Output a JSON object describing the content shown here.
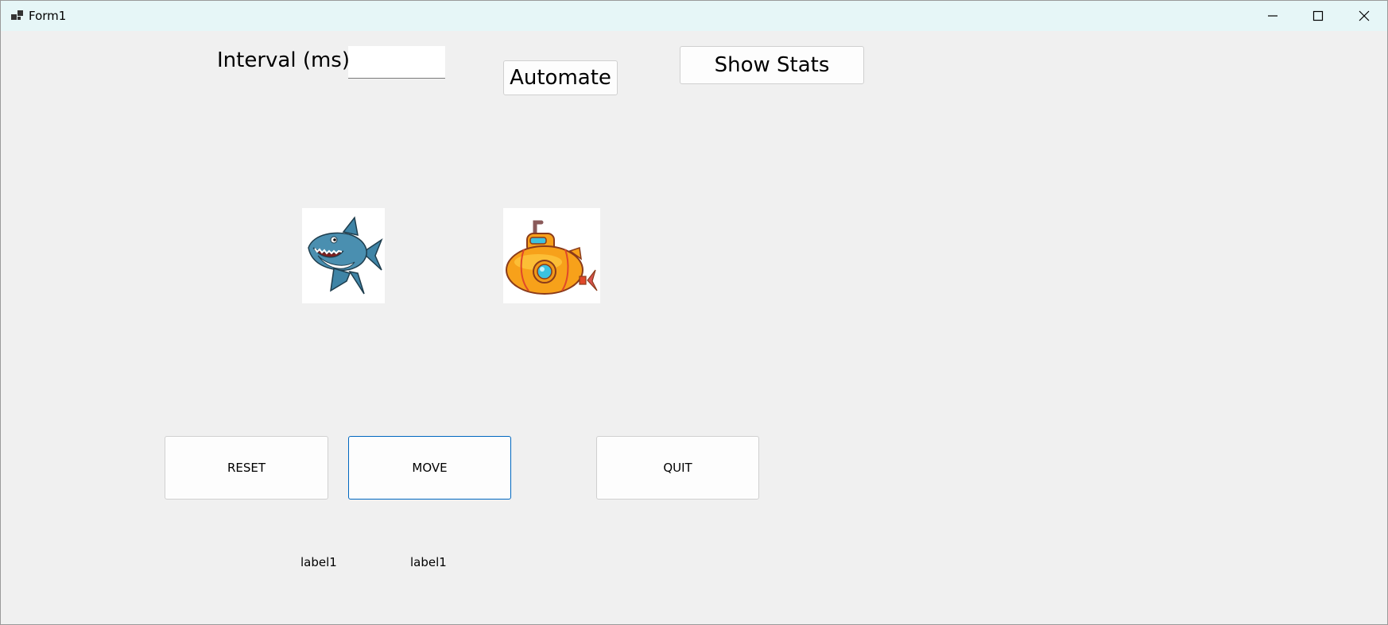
{
  "window": {
    "title": "Form1",
    "icons": {
      "app": "form-app-icon",
      "minimize": "minimize-icon",
      "maximize": "maximize-icon",
      "close": "close-icon"
    }
  },
  "controls": {
    "interval_label": "Interval (ms)",
    "interval_value": "",
    "automate_label": "Automate",
    "show_stats_label": "Show Stats",
    "reset_label": "RESET",
    "move_label": "MOVE",
    "quit_label": "QUIT"
  },
  "images": {
    "shark": "shark-image",
    "submarine": "submarine-image"
  },
  "labels": {
    "label_a": "label1",
    "label_b": "label1"
  },
  "colors": {
    "titlebar_bg": "#e6f6f7",
    "client_bg": "#f0f0f0",
    "focus_border": "#0067c0",
    "shark_body": "#4a8fb0",
    "submarine_body": "#f7a11a"
  }
}
